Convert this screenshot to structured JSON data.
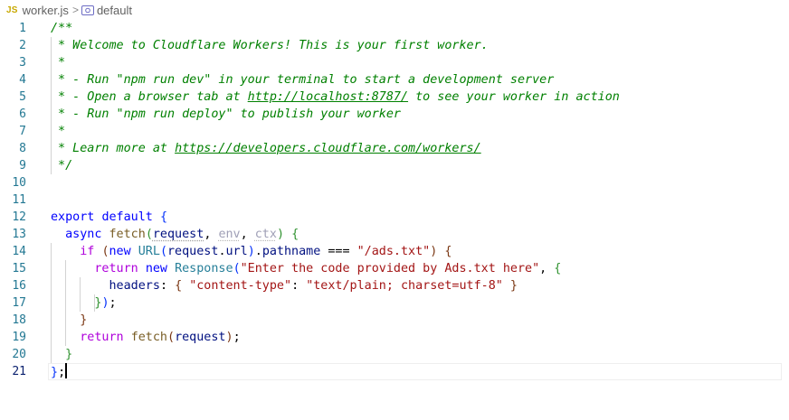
{
  "breadcrumb": {
    "file_icon": "JS",
    "file_name": "worker.js",
    "separator": ">",
    "symbol_icon": "symbol-field-icon",
    "symbol_name": "default"
  },
  "editor": {
    "active_line": 21,
    "line_numbers": [
      "1",
      "2",
      "3",
      "4",
      "5",
      "6",
      "7",
      "8",
      "9",
      "10",
      "11",
      "12",
      "13",
      "14",
      "15",
      "16",
      "17",
      "18",
      "19",
      "20",
      "21"
    ],
    "code": {
      "l1": "/**",
      "l2": " * Welcome to Cloudflare Workers! This is your first worker.",
      "l3": " *",
      "l4": " * - Run \"npm run dev\" in your terminal to start a development server",
      "l5_a": " * - Open a browser tab at ",
      "l5_link": "http://localhost:8787/",
      "l5_b": " to see your worker in action",
      "l6": " * - Run \"npm run deploy\" to publish your worker",
      "l7": " *",
      "l8_a": " * Learn more at ",
      "l8_link": "https://developers.cloudflare.com/workers/",
      "l9": " */",
      "l12_kw1": "export",
      "l12_kw2": "default",
      "l12_brace": "{",
      "l13_kw": "async",
      "l13_fn": "fetch",
      "l13_open": "(",
      "l13_p1": "request",
      "l13_p2": "env",
      "l13_p3": "ctx",
      "l13_close": ")",
      "l13_brace": "{",
      "l14_kw": "if",
      "l14_open": "(",
      "l14_new": "new",
      "l14_type": "URL",
      "l14_open2": "(",
      "l14_obj": "request",
      "l14_prop1": "url",
      "l14_close2": ")",
      "l14_prop2": "pathname",
      "l14_op": "===",
      "l14_str": "\"/ads.txt\"",
      "l14_close": ")",
      "l14_brace": "{",
      "l15_kw": "return",
      "l15_new": "new",
      "l15_type": "Response",
      "l15_open": "(",
      "l15_str": "\"Enter the code provided by Ads.txt here\"",
      "l15_brace": "{",
      "l16_prop": "headers",
      "l16_open": "{",
      "l16_key": "\"content-type\"",
      "l16_val": "\"text/plain; charset=utf-8\"",
      "l16_close": "}",
      "l17_close": "}",
      "l17_paren": ")",
      "l18_close": "}",
      "l19_kw": "return",
      "l19_fn": "fetch",
      "l19_open": "(",
      "l19_arg": "request",
      "l19_close": ")",
      "l20_close": "}",
      "l21_close": "}"
    }
  }
}
